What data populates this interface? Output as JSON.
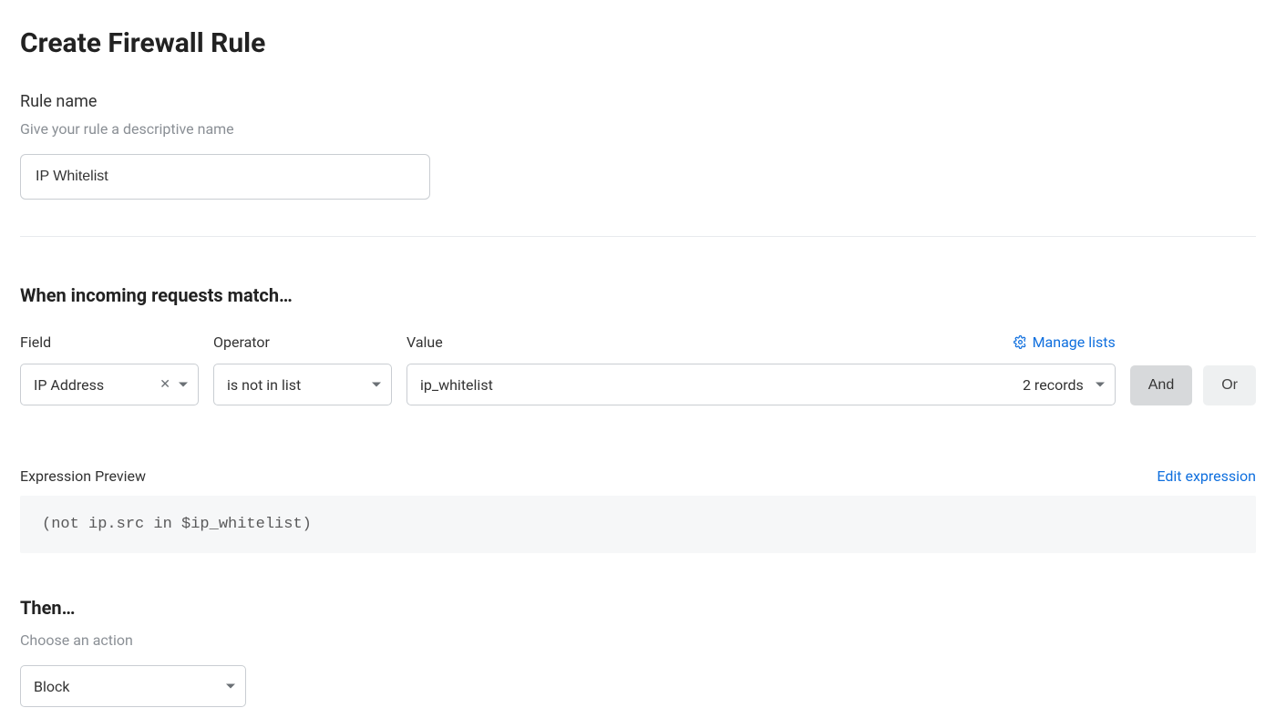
{
  "page_title": "Create Firewall Rule",
  "rule_name": {
    "label": "Rule name",
    "helper": "Give your rule a descriptive name",
    "value": "IP Whitelist"
  },
  "match": {
    "heading": "When incoming requests match…",
    "columns": {
      "field": "Field",
      "operator": "Operator",
      "value": "Value"
    },
    "row": {
      "field_value": "IP Address",
      "operator_value": "is not in list",
      "value_value": "ip_whitelist",
      "records_text": "2 records"
    },
    "manage_lists_label": "Manage lists",
    "and_label": "And",
    "or_label": "Or"
  },
  "expression": {
    "title": "Expression Preview",
    "edit_label": "Edit expression",
    "code": "(not ip.src in $ip_whitelist)"
  },
  "then": {
    "heading": "Then…",
    "helper": "Choose an action",
    "action_value": "Block"
  },
  "colors": {
    "link": "#0f6fde"
  }
}
